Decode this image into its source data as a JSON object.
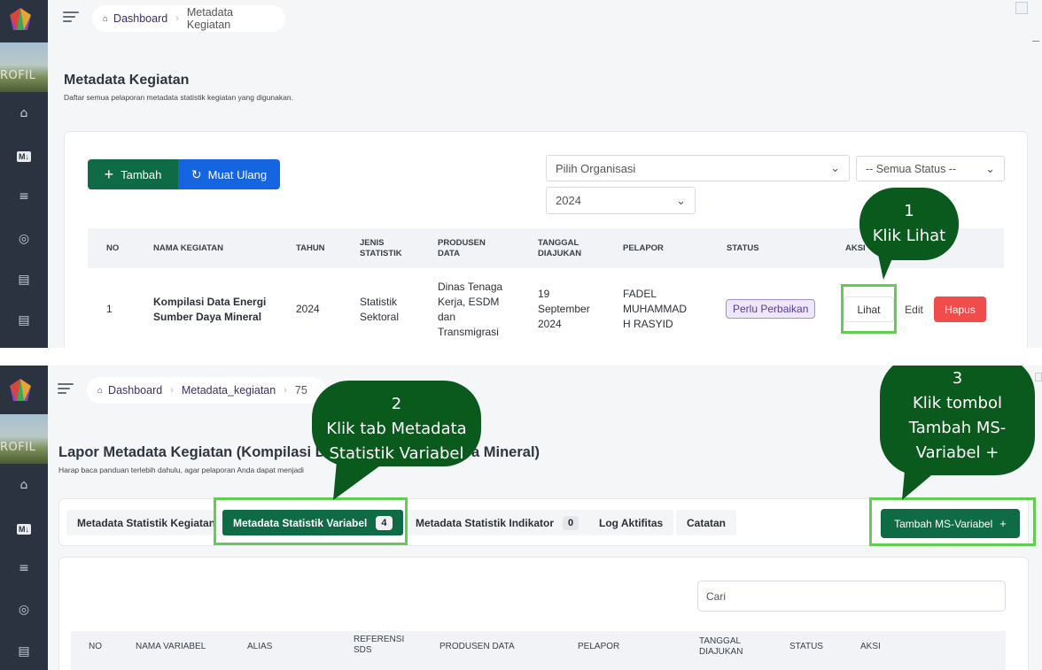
{
  "panel1": {
    "breadcrumb": {
      "home": "Dashboard",
      "current": "Metadata Kegiatan"
    },
    "title": "Metadata Kegiatan",
    "subtitle": "Daftar semua pelaporan metadata statistik kegiatan yang digunakan.",
    "buttons": {
      "add": "Tambah",
      "reload": "Muat Ulang",
      "add_icon": "plus-icon",
      "reload_icon": "refresh-icon"
    },
    "filters": {
      "organization": "Pilih Organisasi",
      "status": "-- Semua Status --",
      "year": "2024"
    },
    "table": {
      "headers": {
        "no": "NO",
        "name": "NAMA KEGIATAN",
        "year": "TAHUN",
        "type_1": "JENIS",
        "type_2": "STATISTIK",
        "producer_1": "PRODUSEN",
        "producer_2": "DATA",
        "date_1": "TANGGAL",
        "date_2": "DIAJUKAN",
        "reporter": "PELAPOR",
        "status": "STATUS",
        "action": "AKSI"
      },
      "row": {
        "no": "1",
        "name_1": "Kompilasi Data Energi",
        "name_2": "Sumber Daya Mineral",
        "year": "2024",
        "type_1": "Statistik",
        "type_2": "Sektoral",
        "producer_1": "Dinas Tenaga",
        "producer_2": "Kerja, ESDM",
        "producer_3": "dan",
        "producer_4": "Transmigrasi",
        "date_1": "19",
        "date_2": "September",
        "date_3": "2024",
        "reporter_1": "FADEL",
        "reporter_2": "MUHAMMAD",
        "reporter_3": "H RASYID",
        "status": "Perlu Perbaikan",
        "view": "Lihat",
        "edit": "Edit",
        "delete": "Hapus"
      }
    },
    "callout": {
      "line1": "1",
      "line2": "Klik Lihat"
    }
  },
  "panel2": {
    "breadcrumb": {
      "home": "Dashboard",
      "mid": "Metadata_kegiatan",
      "current": "75"
    },
    "title_left": "Lapor Metadata Kegiatan (Kompilasi D",
    "title_right": "a Mineral)",
    "subtitle": "Harap baca panduan terlebih dahulu, agar pelaporan Anda dapat menjadi",
    "tabs": [
      {
        "label": "Metadata Statistik Kegiatan"
      },
      {
        "label": "Metadata Statistik Variabel",
        "count": "4"
      },
      {
        "label": "Metadata Statistik Indikator",
        "count": "0"
      },
      {
        "label": "Log Aktifitas"
      },
      {
        "label": "Catatan"
      }
    ],
    "add_variable": "Tambah MS-Variabel",
    "add_variable_icon": "plus-icon",
    "search_placeholder": "Cari",
    "table_headers": {
      "no": "NO",
      "name": "NAMA VARIABEL",
      "alias": "ALIAS",
      "ref_1": "REFERENSI",
      "ref_2": "SDS",
      "producer": "PRODUSEN DATA",
      "reporter": "PELAPOR",
      "date_1": "TANGGAL",
      "date_2": "DIAJUKAN",
      "status": "STATUS",
      "action": "AKSI"
    },
    "callout2": {
      "line1": "2",
      "line2": "Klik tab Metadata",
      "line3": "Statistik Variabel"
    },
    "callout3": {
      "line1": "3",
      "line2": "Klik tombol",
      "line3": "Tambah MS-",
      "line4": "Variabel +"
    }
  },
  "sidebar": {
    "photo_text": "ROFIL",
    "icons": [
      "building-icon",
      "markdown-icon",
      "list-icon",
      "check-circle-icon",
      "document-icon",
      "document-icon"
    ]
  },
  "colors": {
    "sidebar": "#2b3340",
    "primary_green": "#0f6b45",
    "primary_blue": "#1565e0",
    "danger": "#f04c4c",
    "callout": "#0b5a1d",
    "highlight": "#5fcf4f",
    "status_badge": "#efe6ff"
  }
}
